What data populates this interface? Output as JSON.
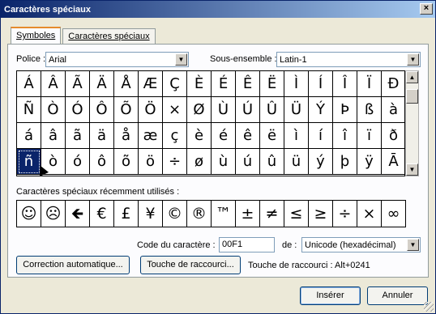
{
  "window": {
    "title": "Caractères spéciaux",
    "close_glyph": "×"
  },
  "tabs": [
    {
      "label": "Symboles",
      "active": true
    },
    {
      "label": "Caractères spéciaux",
      "active": false
    }
  ],
  "font": {
    "label": "Police :",
    "value": "Arial"
  },
  "subset": {
    "label": "Sous-ensemble :",
    "value": "Latin-1"
  },
  "symbols": [
    [
      "Á",
      "Â",
      "Ã",
      "Ä",
      "Å",
      "Æ",
      "Ç",
      "È",
      "É",
      "Ê",
      "Ë",
      "Ì",
      "Í",
      "Î",
      "Ï",
      "Ð"
    ],
    [
      "Ñ",
      "Ò",
      "Ó",
      "Ô",
      "Õ",
      "Ö",
      "×",
      "Ø",
      "Ù",
      "Ú",
      "Û",
      "Ü",
      "Ý",
      "Þ",
      "ß",
      "à"
    ],
    [
      "á",
      "â",
      "ã",
      "ä",
      "å",
      "æ",
      "ç",
      "è",
      "é",
      "ê",
      "ë",
      "ì",
      "í",
      "î",
      "ï",
      "ð"
    ],
    [
      "ñ",
      "ò",
      "ó",
      "ô",
      "õ",
      "ö",
      "÷",
      "ø",
      "ù",
      "ú",
      "û",
      "ü",
      "ý",
      "þ",
      "ÿ",
      "Ā"
    ]
  ],
  "selected": {
    "row": 3,
    "col": 0
  },
  "recent": {
    "label": "Caractères spéciaux récemment utilisés :",
    "items": [
      "☺",
      "☹",
      "🡸",
      "€",
      "£",
      "¥",
      "©",
      "®",
      "™",
      "±",
      "≠",
      "≤",
      "≥",
      "÷",
      "×",
      "∞"
    ]
  },
  "char_code": {
    "label": "Code du caractère :",
    "value": "00F1"
  },
  "from": {
    "label": "de :",
    "value": "Unicode (hexadécimal)"
  },
  "buttons": {
    "autocorrect": "Correction automatique...",
    "shortcut_key": "Touche de raccourci...",
    "insert": "Insérer",
    "cancel": "Annuler"
  },
  "shortcut_text": "Touche de raccourci : Alt+0241",
  "icons": {
    "dropdown": "chevron-down-icon",
    "scroll_up": "chevron-up-icon",
    "scroll_down": "chevron-down-icon"
  }
}
